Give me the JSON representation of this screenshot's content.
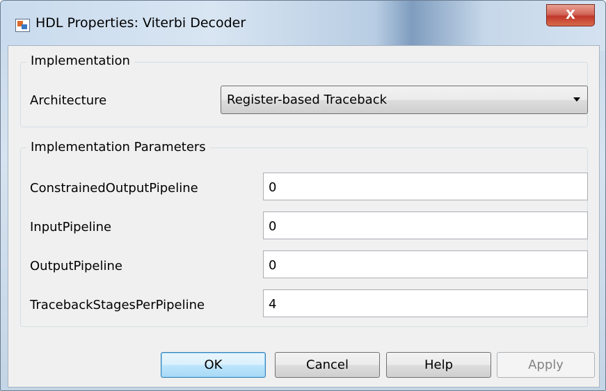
{
  "window": {
    "title": "HDL Properties: Viterbi Decoder",
    "close_label": "X"
  },
  "implementation": {
    "legend": "Implementation",
    "architecture_label": "Architecture",
    "architecture_value": "Register-based Traceback"
  },
  "parameters": {
    "legend": "Implementation Parameters",
    "rows": [
      {
        "label": "ConstrainedOutputPipeline",
        "value": "0"
      },
      {
        "label": "InputPipeline",
        "value": "0"
      },
      {
        "label": "OutputPipeline",
        "value": "0"
      },
      {
        "label": "TracebackStagesPerPipeline",
        "value": "4"
      }
    ]
  },
  "buttons": {
    "ok": "OK",
    "cancel": "Cancel",
    "help": "Help",
    "apply": "Apply"
  }
}
